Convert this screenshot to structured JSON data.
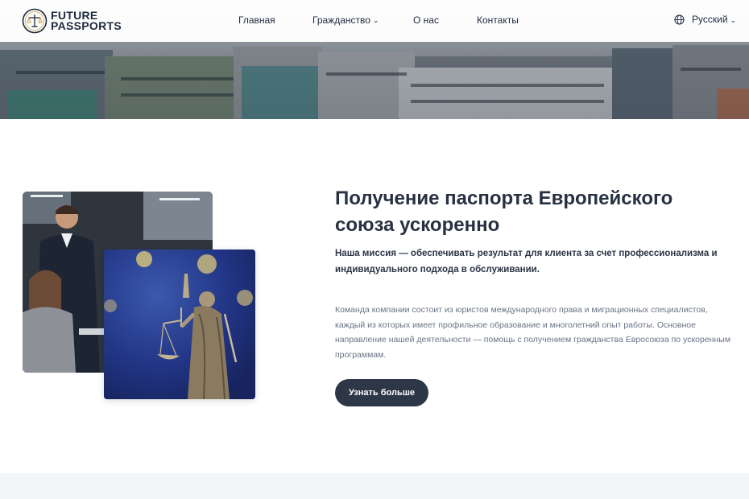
{
  "brand": {
    "line1": "FUTURE",
    "line2": "PASSPORTS"
  },
  "nav": {
    "home": "Главная",
    "citizenship": "Гражданство",
    "about": "О нас",
    "contacts": "Контакты"
  },
  "language": {
    "current": "Русский"
  },
  "intro": {
    "headline": "Получение паспорта Европейского союза ускоренно",
    "mission": "Наша миссия — обеспечивать результат для клиента за счет профессионализма и индивидуального подхода в обслуживании.",
    "description": "Команда компании состоит из юристов международного права и миграционных специалистов, каждый из которых имеет профильное образование и многолетний опыт работы. Основное направление нашей деятельности — помощь с получением гражданства Евросоюза по ускоренным программам.",
    "cta": "Узнать больше"
  },
  "icons": {
    "logo": "scales-emblem-icon",
    "globe": "globe-icon",
    "chevron": "chevron-down-icon"
  },
  "colors": {
    "primary": "#2d3748",
    "text": "#283142",
    "muted": "#6a7384",
    "accent_gold": "#c9a14a"
  }
}
